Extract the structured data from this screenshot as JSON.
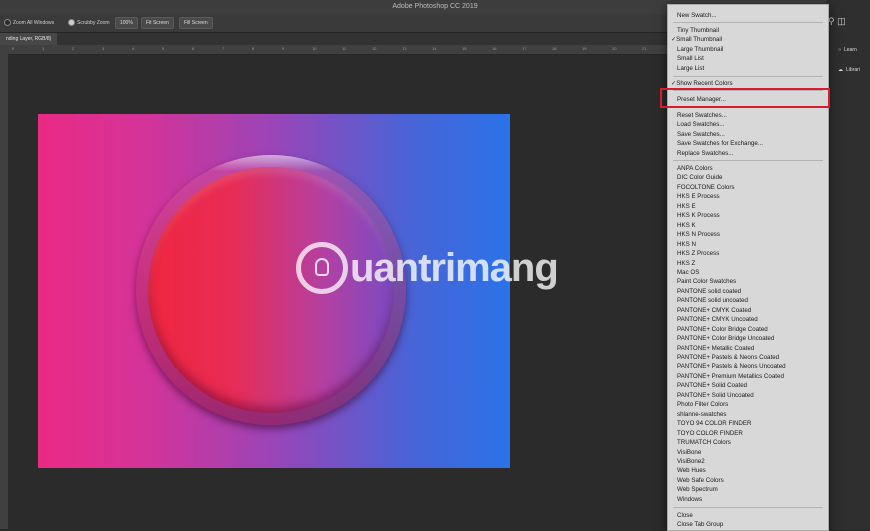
{
  "app": {
    "title": "Adobe Photoshop CC 2019"
  },
  "options_bar": {
    "zoom_all_windows": "Zoom All Windows",
    "scrubby_zoom": "Scrubby Zoom",
    "zoom_pct": "100%",
    "fit_screen": "Fit Screen",
    "fill_screen": "Fill Screen"
  },
  "document_tab": {
    "label": "nding Layer, RGB/8)"
  },
  "ruler_ticks": [
    "0",
    "1",
    "2",
    "3",
    "4",
    "5",
    "6",
    "7",
    "8",
    "9",
    "10",
    "11",
    "12",
    "13",
    "14",
    "15",
    "16",
    "17",
    "18",
    "19",
    "20",
    "21",
    "22",
    "23",
    "24",
    "25",
    "26",
    "27"
  ],
  "watermark": {
    "text": "uantrimang"
  },
  "right_panel": {
    "learn": "Learn",
    "libraries": "Librari"
  },
  "menu": {
    "new_swatch": "New Swatch...",
    "views": [
      "Tiny Thumbnail",
      "Small Thumbnail",
      "Large Thumbnail",
      "Small List",
      "Large List"
    ],
    "checked_view": "Small Thumbnail",
    "show_recent": "Show Recent Colors",
    "preset_manager": "Preset Manager...",
    "file_actions": [
      "Reset Swatches...",
      "Load Swatches...",
      "Save Swatches...",
      "Save Swatches for Exchange...",
      "Replace Swatches..."
    ],
    "libraries": [
      "ANPA Colors",
      "DIC Color Guide",
      "FOCOLTONE Colors",
      "HKS E Process",
      "HKS E",
      "HKS K Process",
      "HKS K",
      "HKS N Process",
      "HKS N",
      "HKS Z Process",
      "HKS Z",
      "Mac OS",
      "Paint Color Swatches",
      "PANTONE solid coated",
      "PANTONE solid uncoated",
      "PANTONE+ CMYK Coated",
      "PANTONE+ CMYK Uncoated",
      "PANTONE+ Color Bridge Coated",
      "PANTONE+ Color Bridge Uncoated",
      "PANTONE+ Metallic Coated",
      "PANTONE+ Pastels & Neons Coated",
      "PANTONE+ Pastels & Neons Uncoated",
      "PANTONE+ Premium Metallics Coated",
      "PANTONE+ Solid Coated",
      "PANTONE+ Solid Uncoated",
      "Photo Filter Colors",
      "shlanne-swatches",
      "TOYO 94 COLOR FINDER",
      "TOYO COLOR FINDER",
      "TRUMATCH Colors",
      "VisiBone",
      "VisiBone2",
      "Web Hues",
      "Web Safe Colors",
      "Web Spectrum",
      "Windows"
    ],
    "close_items": [
      "Close",
      "Close Tab Group"
    ]
  },
  "colors": {
    "highlight": "#d21f2b",
    "canvas_left": "#ea2a84",
    "canvas_right": "#2a73e8"
  }
}
